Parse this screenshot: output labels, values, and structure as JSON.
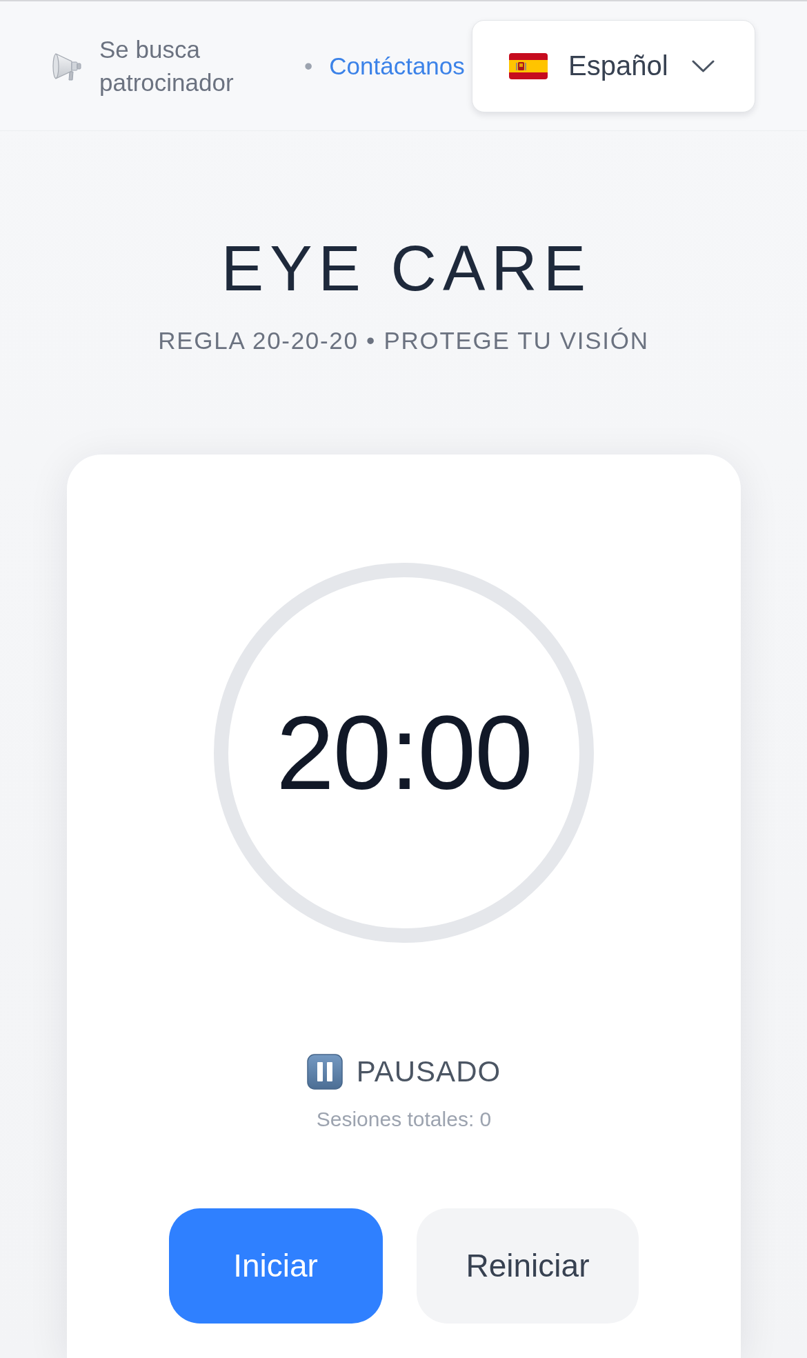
{
  "header": {
    "sponsor": "Se busca patrocinador",
    "separator": "•",
    "contact_link": "Contáctanos",
    "language_select": {
      "value": "Español"
    }
  },
  "hero": {
    "title": "EYE CARE",
    "subtitle": "REGLA 20-20-20 • PROTEGE TU VISIÓN"
  },
  "timer": {
    "time": "20:00",
    "status": {
      "kind": "paused",
      "label": "PAUSADO"
    },
    "sessions": "Sesiones totales: 0"
  },
  "buttons": [
    {
      "label": "Iniciar",
      "kind": "primary"
    },
    {
      "label": "Reiniciar",
      "kind": "secondary"
    }
  ]
}
